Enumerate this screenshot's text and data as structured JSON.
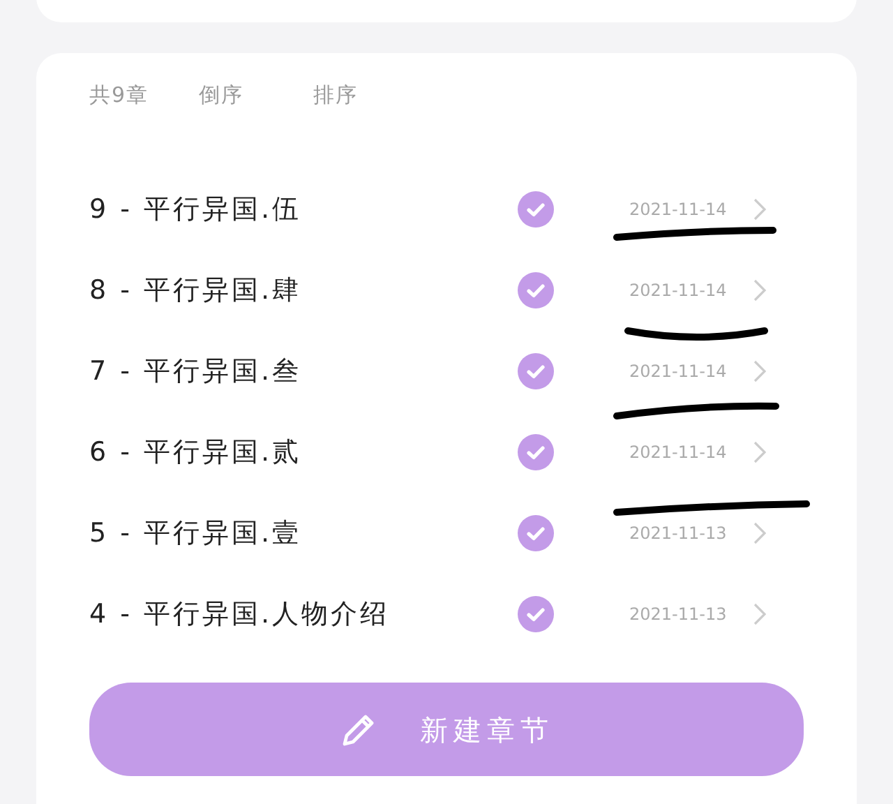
{
  "header": {
    "count": "共9章",
    "actions": [
      {
        "label": "倒序"
      },
      {
        "label": "排序"
      }
    ]
  },
  "chapters": [
    {
      "title": "9 - 平行异国.伍",
      "checked": true,
      "date": "2021-11-14"
    },
    {
      "title": "8 - 平行异国.肆",
      "checked": true,
      "date": "2021-11-14"
    },
    {
      "title": "7 - 平行异国.叁",
      "checked": true,
      "date": "2021-11-14"
    },
    {
      "title": "6 - 平行异国.贰",
      "checked": true,
      "date": "2021-11-14"
    },
    {
      "title": "5 - 平行异国.壹",
      "checked": true,
      "date": "2021-11-13"
    },
    {
      "title": "4 - 平行异国.人物介绍",
      "checked": true,
      "date": "2021-11-13"
    }
  ],
  "new_button": {
    "label": "新建章节"
  }
}
